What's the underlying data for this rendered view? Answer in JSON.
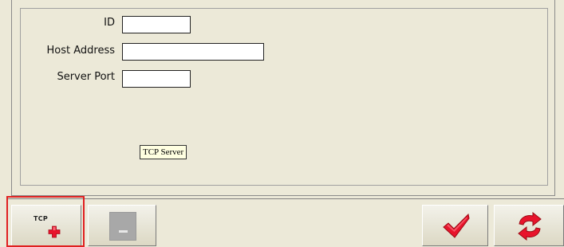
{
  "form": {
    "id_label": "ID",
    "id_value": "",
    "host_label": "Host Address",
    "host_value": "",
    "port_label": "Server Port",
    "port_value": "",
    "tooltip": "TCP Server"
  },
  "toolbar": {
    "add_tcp_text": "TCP",
    "add_tcp_icon": "plus-icon",
    "remove_icon": "minus-icon",
    "confirm_icon": "check-icon",
    "refresh_icon": "refresh-icon"
  },
  "colors": {
    "background": "#ece9d8",
    "highlight": "#e02020",
    "icon_red": "#e8142c"
  }
}
